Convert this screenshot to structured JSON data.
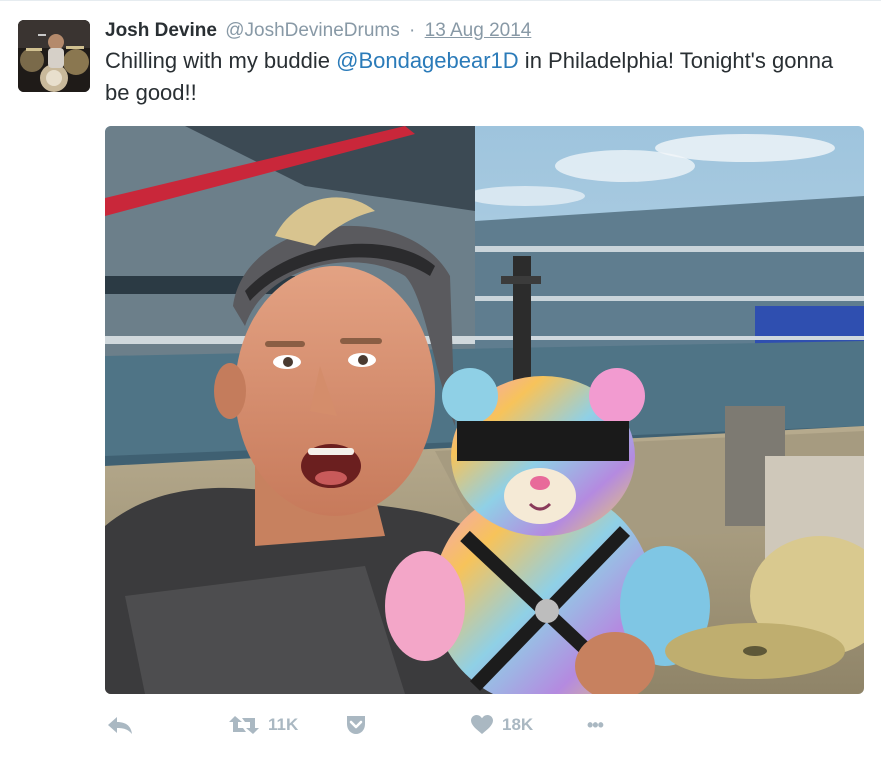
{
  "tweet": {
    "author_name": "Josh Devine",
    "author_handle": "@JoshDevineDrums",
    "separator": "·",
    "date": "13 Aug 2014",
    "text_before": "Chilling with my buddie ",
    "mention": "@Bondagebear1D",
    "text_after": " in Philadelphia! Tonight's gonna be good!!"
  },
  "actions": {
    "retweet_count": "11K",
    "like_count": "18K",
    "more_label": "•••"
  },
  "icons": {
    "reply": "reply-icon",
    "retweet": "retweet-icon",
    "pocket": "pocket-icon",
    "like": "heart-icon",
    "more": "more-icon"
  },
  "colors": {
    "text": "#292f33",
    "muted": "#8899a6",
    "link": "#2b7bb9",
    "action": "#aab8c2"
  }
}
